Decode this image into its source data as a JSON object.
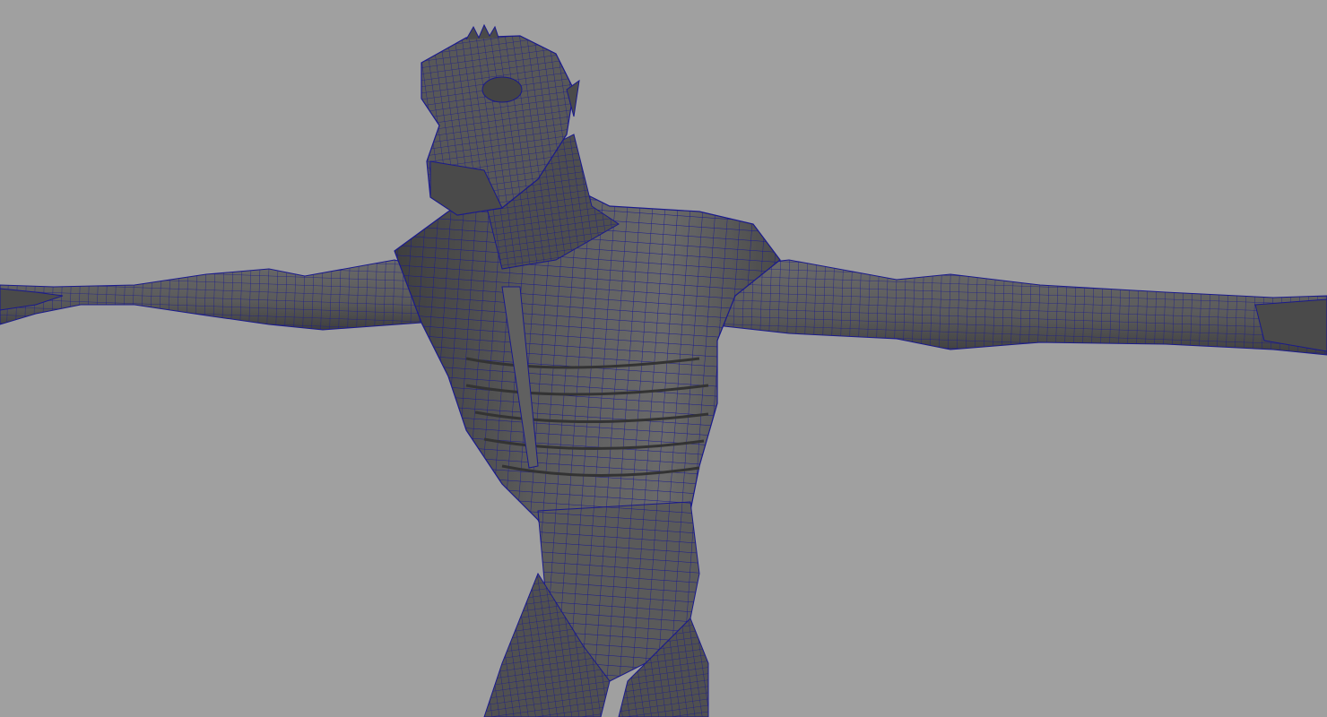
{
  "viewport": {
    "background_color": "#a0a0a0",
    "shading": "smooth-shade-with-wireframe",
    "mesh_fill_color": "#555555",
    "mesh_fill_shadow": "#3e3e3e",
    "mesh_highlight": "#6e6e6e",
    "wireframe_color": "#1a1a8c",
    "subject": "creature-t-pose-mesh"
  }
}
